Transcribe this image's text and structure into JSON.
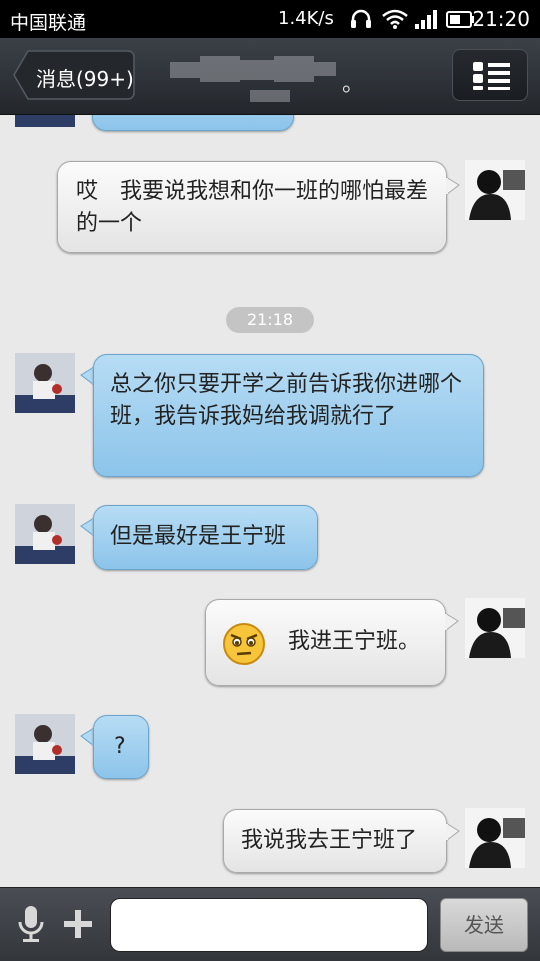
{
  "status_bar": {
    "carrier": "中国联通",
    "speed": "1.4K/s",
    "time": "21:20",
    "icons": [
      "headset-icon",
      "wifi-icon",
      "signal-icon",
      "battery-icon"
    ]
  },
  "header": {
    "back_label": "消息(99+)",
    "title_suffix": "。",
    "menu_icon": "list-menu-icon"
  },
  "messages": {
    "m1": {
      "text": "",
      "side": "in"
    },
    "m2": {
      "text": "哎　我要说我想和你一班的哪怕最差的一个",
      "side": "out"
    },
    "ts": "21:18",
    "m3": {
      "text": "总之你只要开学之前告诉我你进哪个班，我告诉我妈给我调就行了",
      "side": "in"
    },
    "m4": {
      "text": "但是最好是王宁班",
      "side": "in"
    },
    "m5": {
      "text": "我进王宁班。",
      "side": "out",
      "emoji": "skeptical-face-emoji"
    },
    "m6": {
      "text": "?",
      "side": "in"
    },
    "m7": {
      "text": "我说我去王宁班了",
      "side": "out"
    }
  },
  "input_bar": {
    "send_label": "发送",
    "input_value": "",
    "mic_icon": "microphone-icon",
    "plus_icon": "plus-icon"
  },
  "colors": {
    "incoming_bubble": "#9fd0f0",
    "outgoing_bubble": "#f2f2f2",
    "header_bg": "#2f3338",
    "chat_bg": "#e9e9e9"
  }
}
